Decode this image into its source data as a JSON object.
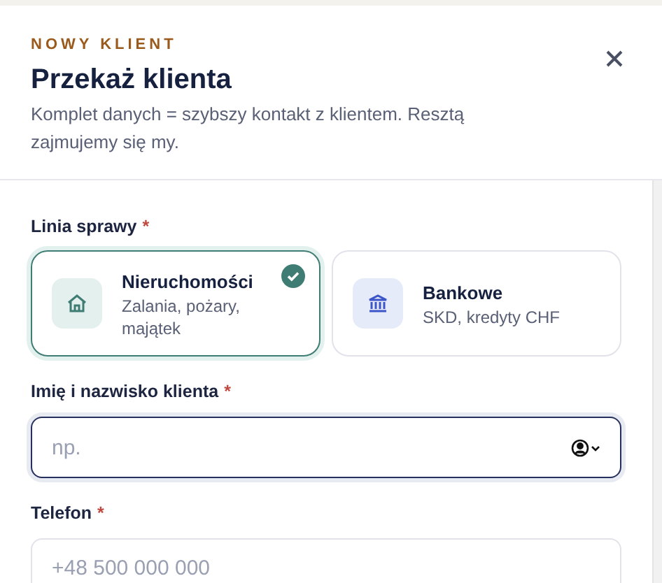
{
  "header": {
    "eyebrow": "NOWY KLIENT",
    "title": "Przekaż klienta",
    "subtitle": "Komplet danych = szybszy kontakt z klientem. Resztą zajmujemy się my."
  },
  "case_line": {
    "label": "Linia sprawy",
    "required_mark": "*",
    "options": [
      {
        "kind": "house",
        "title": "Nieruchomości",
        "description": "Zalania, pożary, majątek",
        "selected": true
      },
      {
        "kind": "bank",
        "title": "Bankowe",
        "description": "SKD, kredyty CHF",
        "selected": false
      }
    ]
  },
  "fields": [
    {
      "kind": "contact",
      "label": "Imię i nazwisko klienta",
      "required_mark": "*",
      "placeholder": "np.",
      "focused": true
    },
    {
      "kind": "plain",
      "label": "Telefon",
      "required_mark": "*",
      "placeholder": "+48 500 000 000",
      "focused": false
    }
  ]
}
